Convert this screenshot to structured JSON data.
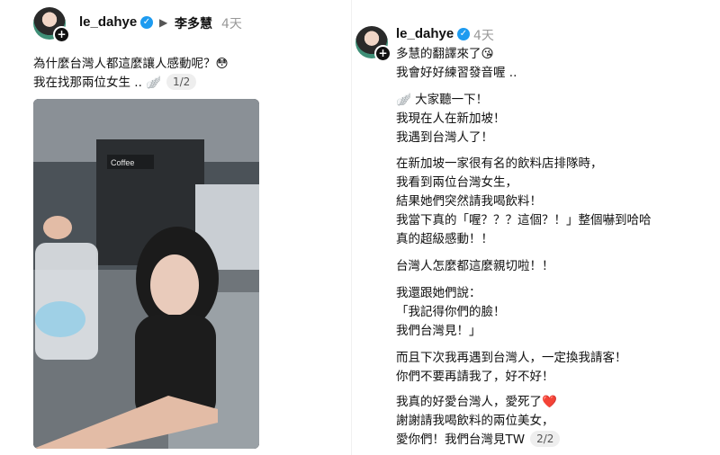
{
  "left_post": {
    "username": "le_dahye",
    "name": "李多慧",
    "time": "4天",
    "lines": [
      "為什麼台灣人都這麼讓人感動呢？😳",
      "我在找那兩位女生 .. 🪽"
    ],
    "page_indicator": "1/2",
    "photo_sign": "Coffee"
  },
  "right_post": {
    "username": "le_dahye",
    "time": "4天",
    "paragraphs": [
      [
        "多慧的翻譯來了😘",
        "我會好好練習發音喔 .."
      ],
      [
        "🪽 大家聽一下！",
        "我現在人在新加坡！",
        "我遇到台灣人了！"
      ],
      [
        "在新加坡一家很有名的飲料店排隊時，",
        "我看到兩位台灣女生，",
        "結果她們突然請我喝飲料！",
        "我當下真的「喔？？？這個？！」整個嚇到哈哈",
        "真的超級感動！！"
      ],
      [
        "台灣人怎麼都這麼親切啦！！"
      ],
      [
        "我還跟她們說：",
        "「我記得你們的臉！",
        "我們台灣見！」"
      ],
      [
        "而且下次我再遇到台灣人，一定換我請客！",
        "你們不要再請我了，好不好！"
      ],
      [
        "我真的好愛台灣人，愛死了❤️",
        "謝謝請我喝飲料的兩位美女，",
        "愛你們！我們台灣見TW"
      ]
    ],
    "page_indicator": "2/2"
  },
  "colors": {
    "verified": "#1d9bf0",
    "time": "#999999",
    "badge_bg": "#eeeeee"
  }
}
